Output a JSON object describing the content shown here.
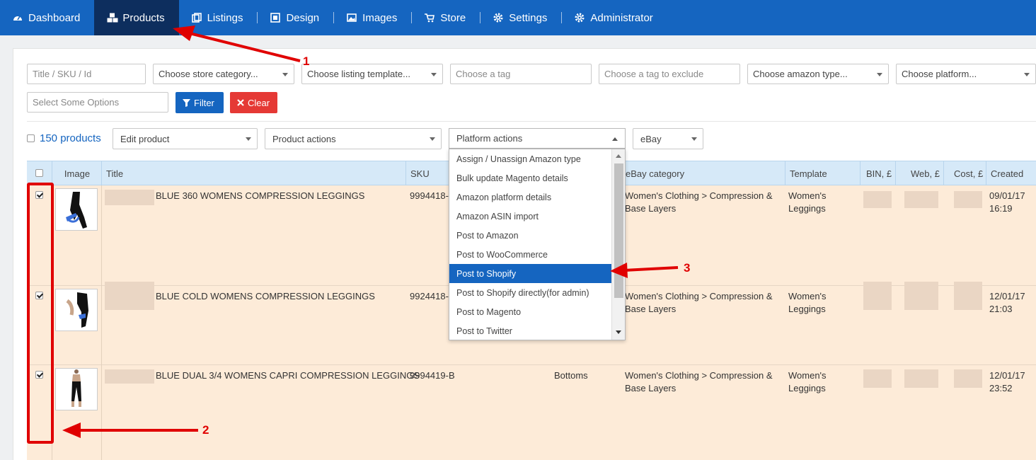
{
  "nav": {
    "items": [
      {
        "label": "Dashboard",
        "icon": "dashboard-icon"
      },
      {
        "label": "Products",
        "icon": "cubes-icon",
        "active": true
      },
      {
        "label": "Listings",
        "icon": "listings-icon"
      },
      {
        "label": "Design",
        "icon": "design-icon"
      },
      {
        "label": "Images",
        "icon": "image-icon"
      },
      {
        "label": "Store",
        "icon": "cart-icon"
      },
      {
        "label": "Settings",
        "icon": "gear-icon"
      },
      {
        "label": "Administrator",
        "icon": "gear-icon"
      }
    ],
    "bg_color": "#1565c0",
    "active_color": "#0d2e5e"
  },
  "filters": {
    "title_sku_placeholder": "Title / SKU / Id",
    "store_category": "Choose store category...",
    "listing_template": "Choose listing template...",
    "tag_placeholder": "Choose a tag",
    "tag_exclude_placeholder": "Choose a tag to exclude",
    "amazon_type": "Choose amazon type...",
    "platform": "Choose platform...",
    "options_placeholder": "Select Some Options",
    "filter_button": "Filter",
    "clear_button": "Clear"
  },
  "toolbar": {
    "product_count": "150 products",
    "edit_product": "Edit product",
    "product_actions": "Product actions",
    "platform_actions": "Platform actions",
    "marketplace": "eBay"
  },
  "platform_menu": {
    "options": [
      "Assign / Unassign Amazon type",
      "Bulk update Magento details",
      "Amazon platform details",
      "Amazon ASIN import",
      "Post to Amazon",
      "Post to WooCommerce",
      "Post to Shopify",
      "Post to Shopify directly(for admin)",
      "Post to Magento",
      "Post to Twitter"
    ],
    "selected": "Post to Shopify"
  },
  "table": {
    "headers": {
      "image": "Image",
      "title": "Title",
      "sku": "SKU",
      "ebay_category": "eBay category",
      "template": "Template",
      "bin": "BIN, £",
      "web": "Web, £",
      "cost": "Cost, £",
      "created": "Created"
    },
    "rows": [
      {
        "title": "BLUE 360 WOMENS COMPRESSION LEGGINGS",
        "sku": "9994418-",
        "category": "",
        "ebay_category_line1": "Women's Clothing > Compression &",
        "ebay_category_line2": "Base Layers",
        "template_line1": "Women's",
        "template_line2": "Leggings",
        "created_date": "09/01/17",
        "created_time": "16:19",
        "checked": true
      },
      {
        "title": "BLUE COLD WOMENS COMPRESSION LEGGINGS",
        "sku": "9924418-",
        "category": "",
        "ebay_category_line1": "Women's Clothing > Compression &",
        "ebay_category_line2": "Base Layers",
        "template_line1": "Women's",
        "template_line2": "Leggings",
        "created_date": "12/01/17",
        "created_time": "21:03",
        "checked": true
      },
      {
        "title": "BLUE DUAL 3/4 WOMENS CAPRI COMPRESSION LEGGINGS",
        "sku": "9994419-B",
        "category": "Bottoms",
        "ebay_category_line1": "Women's Clothing > Compression &",
        "ebay_category_line2": "Base Layers",
        "template_line1": "Women's",
        "template_line2": "Leggings",
        "created_date": "12/01/17",
        "created_time": "23:52",
        "checked": true
      }
    ]
  },
  "annotations": {
    "one": "1",
    "two": "2",
    "three": "3",
    "color": "#e00000"
  }
}
